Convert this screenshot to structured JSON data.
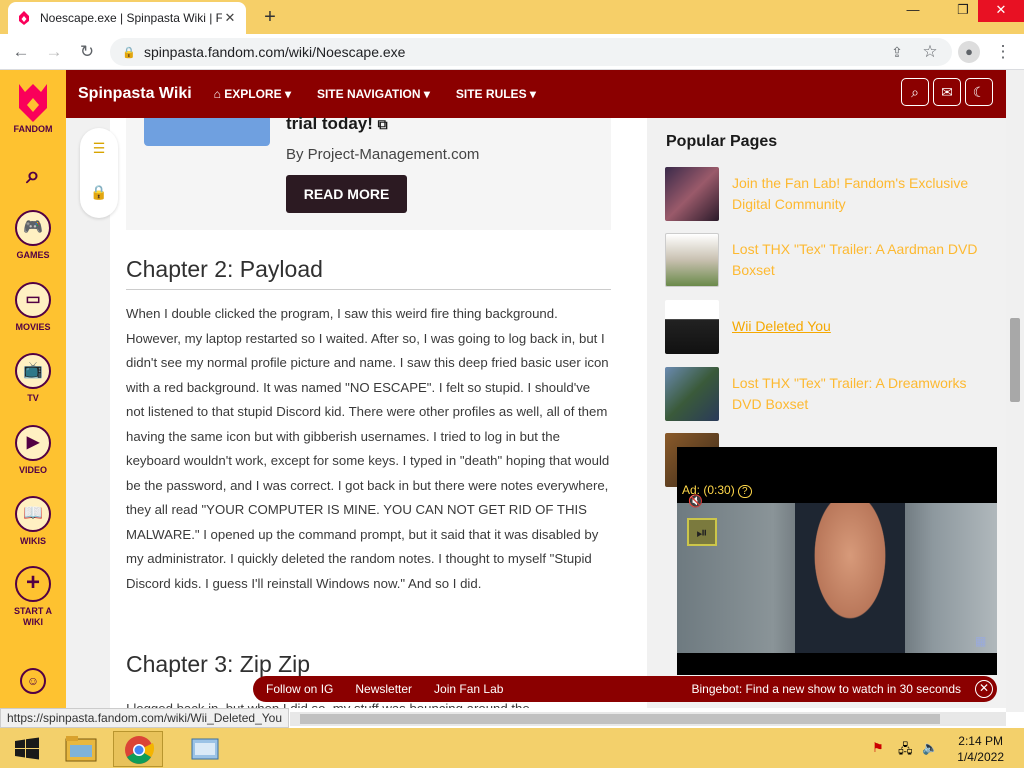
{
  "browser": {
    "tab_title": "Noescape.exe | Spinpasta Wiki | F",
    "url": "spinpasta.fandom.com/wiki/Noescape.exe",
    "status_url": "https://spinpasta.fandom.com/wiki/Wii_Deleted_You"
  },
  "rail": {
    "brand": "FANDOM",
    "items": [
      {
        "label": "GAMES",
        "icon": "games-icon"
      },
      {
        "label": "MOVIES",
        "icon": "movies-icon"
      },
      {
        "label": "TV",
        "icon": "tv-icon"
      },
      {
        "label": "VIDEO",
        "icon": "video-icon"
      },
      {
        "label": "WIKIS",
        "icon": "wikis-icon"
      },
      {
        "label": "START A WIKI",
        "icon": "plus-icon"
      }
    ]
  },
  "wiki": {
    "name": "Spinpasta Wiki",
    "nav": [
      "EXPLORE",
      "SITE NAVIGATION",
      "SITE RULES"
    ]
  },
  "ad": {
    "title": "trial today!",
    "by": "By Project-Management.com",
    "cta": "READ MORE"
  },
  "article": {
    "chapter2": "Chapter 2: Payload",
    "paragraph": "When I double clicked the program, I saw this weird fire thing background. However, my laptop restarted so I waited. After so, I was going to log back in, but I didn't see my normal profile picture and name. I saw this deep fried basic user icon with a red background. It was named \"NO ESCAPE\". I felt so stupid. I should've not listened to that stupid Discord kid. There were other profiles as well, all of them having the same icon but with gibberish usernames. I tried to log in but the keyboard wouldn't work, except for some keys. I typed in \"death\" hoping that would be the password, and I was correct. I got back in but there were notes everywhere, they all read \"YOUR COMPUTER IS MINE. YOU CAN NOT GET RID OF THIS MALWARE.\" I opened up the command prompt, but it said that it was disabled by my administrator. I quickly deleted the random notes. I thought to myself \"Stupid Discord kids. I guess I'll reinstall Windows now.\" And so I did.",
    "chapter3": "Chapter 3: Zip Zip",
    "paragraph2_start": "I logged back in, but when I did so, my stuff was bouncing around the"
  },
  "sidebar": {
    "heading": "Popular Pages",
    "items": [
      {
        "label": "Join the Fan Lab! Fandom's Exclusive Digital Community",
        "color": "#6a3a55"
      },
      {
        "label": "Lost THX \"Tex\" Trailer: A Aardman DVD Boxset",
        "color": "#d8d0c4"
      },
      {
        "label": "Wii Deleted You",
        "color": "#2a2a2a"
      },
      {
        "label": "Lost THX \"Tex\" Trailer: A Dreamworks DVD Boxset",
        "color": "#4a6a8a"
      }
    ]
  },
  "video_ad": {
    "label": "Ad: (0:30)"
  },
  "fanbar": {
    "links": [
      "Follow on IG",
      "Newsletter",
      "Join Fan Lab"
    ],
    "promo": "Bingebot: Find a new show to watch in 30 seconds"
  },
  "taskbar": {
    "time": "2:14 PM",
    "date": "1/4/2022"
  },
  "colors": {
    "wiki_header": "#8b0000",
    "rail": "#fec230",
    "link": "#fdb931"
  }
}
